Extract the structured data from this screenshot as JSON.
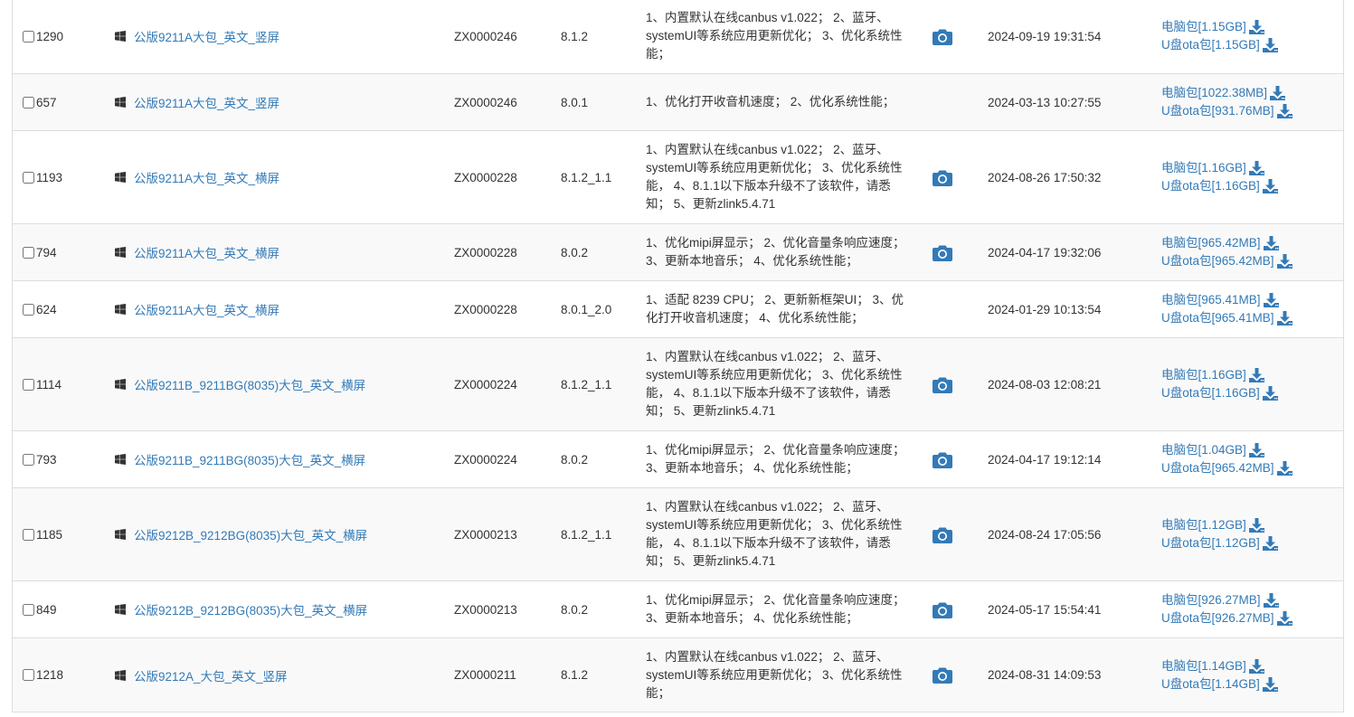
{
  "colors": {
    "link": "#337ab7",
    "border": "#dddddd",
    "stripe": "#f9f9f9",
    "text": "#333333"
  },
  "rows": [
    {
      "id": "1290",
      "name": "公版9211A大包_英文_竖屏",
      "code": "ZX0000246",
      "version": "8.1.2",
      "desc": "1、内置默认在线canbus v1.022； 2、蓝牙、systemUI等系统应用更新优化； 3、优化系统性能；",
      "has_camera": true,
      "time": "2024-09-19 19:31:54",
      "pc_label": "电脑包[1.15GB]",
      "usb_label": "U盘ota包[1.15GB]"
    },
    {
      "id": "657",
      "name": "公版9211A大包_英文_竖屏",
      "code": "ZX0000246",
      "version": "8.0.1",
      "desc": "1、优化打开收音机速度； 2、优化系统性能；",
      "has_camera": false,
      "time": "2024-03-13 10:27:55",
      "pc_label": "电脑包[1022.38MB]",
      "usb_label": "U盘ota包[931.76MB]"
    },
    {
      "id": "1193",
      "name": "公版9211A大包_英文_横屏",
      "code": "ZX0000228",
      "version": "8.1.2_1.1",
      "desc": "1、内置默认在线canbus v1.022； 2、蓝牙、systemUI等系统应用更新优化； 3、优化系统性能， 4、8.1.1以下版本升级不了该软件，请悉知； 5、更新zlink5.4.71",
      "has_camera": true,
      "time": "2024-08-26 17:50:32",
      "pc_label": "电脑包[1.16GB]",
      "usb_label": "U盘ota包[1.16GB]"
    },
    {
      "id": "794",
      "name": "公版9211A大包_英文_横屏",
      "code": "ZX0000228",
      "version": "8.0.2",
      "desc": "1、优化mipi屏显示； 2、优化音量条响应速度； 3、更新本地音乐； 4、优化系统性能；",
      "has_camera": true,
      "time": "2024-04-17 19:32:06",
      "pc_label": "电脑包[965.42MB]",
      "usb_label": "U盘ota包[965.42MB]"
    },
    {
      "id": "624",
      "name": "公版9211A大包_英文_横屏",
      "code": "ZX0000228",
      "version": "8.0.1_2.0",
      "desc": "1、适配 8239 CPU； 2、更新新框架UI； 3、优化打开收音机速度； 4、优化系统性能；",
      "has_camera": false,
      "time": "2024-01-29 10:13:54",
      "pc_label": "电脑包[965.41MB]",
      "usb_label": "U盘ota包[965.41MB]"
    },
    {
      "id": "1114",
      "name": "公版9211B_9211BG(8035)大包_英文_横屏",
      "code": "ZX0000224",
      "version": "8.1.2_1.1",
      "desc": "1、内置默认在线canbus v1.022； 2、蓝牙、systemUI等系统应用更新优化； 3、优化系统性能， 4、8.1.1以下版本升级不了该软件，请悉知； 5、更新zlink5.4.71",
      "has_camera": true,
      "time": "2024-08-03 12:08:21",
      "pc_label": "电脑包[1.16GB]",
      "usb_label": "U盘ota包[1.16GB]"
    },
    {
      "id": "793",
      "name": "公版9211B_9211BG(8035)大包_英文_横屏",
      "code": "ZX0000224",
      "version": "8.0.2",
      "desc": "1、优化mipi屏显示； 2、优化音量条响应速度； 3、更新本地音乐； 4、优化系统性能；",
      "has_camera": true,
      "time": "2024-04-17 19:12:14",
      "pc_label": "电脑包[1.04GB]",
      "usb_label": "U盘ota包[965.42MB]"
    },
    {
      "id": "1185",
      "name": "公版9212B_9212BG(8035)大包_英文_横屏",
      "code": "ZX0000213",
      "version": "8.1.2_1.1",
      "desc": "1、内置默认在线canbus v1.022； 2、蓝牙、systemUI等系统应用更新优化； 3、优化系统性能， 4、8.1.1以下版本升级不了该软件，请悉知； 5、更新zlink5.4.71",
      "has_camera": true,
      "time": "2024-08-24 17:05:56",
      "pc_label": "电脑包[1.12GB]",
      "usb_label": "U盘ota包[1.12GB]"
    },
    {
      "id": "849",
      "name": "公版9212B_9212BG(8035)大包_英文_横屏",
      "code": "ZX0000213",
      "version": "8.0.2",
      "desc": "1、优化mipi屏显示； 2、优化音量条响应速度； 3、更新本地音乐； 4、优化系统性能；",
      "has_camera": true,
      "time": "2024-05-17 15:54:41",
      "pc_label": "电脑包[926.27MB]",
      "usb_label": "U盘ota包[926.27MB]"
    },
    {
      "id": "1218",
      "name": "公版9212A_大包_英文_竖屏",
      "code": "ZX0000211",
      "version": "8.1.2",
      "desc": "1、内置默认在线canbus v1.022； 2、蓝牙、systemUI等系统应用更新优化； 3、优化系统性能；",
      "has_camera": true,
      "time": "2024-08-31 14:09:53",
      "pc_label": "电脑包[1.14GB]",
      "usb_label": "U盘ota包[1.14GB]"
    }
  ]
}
